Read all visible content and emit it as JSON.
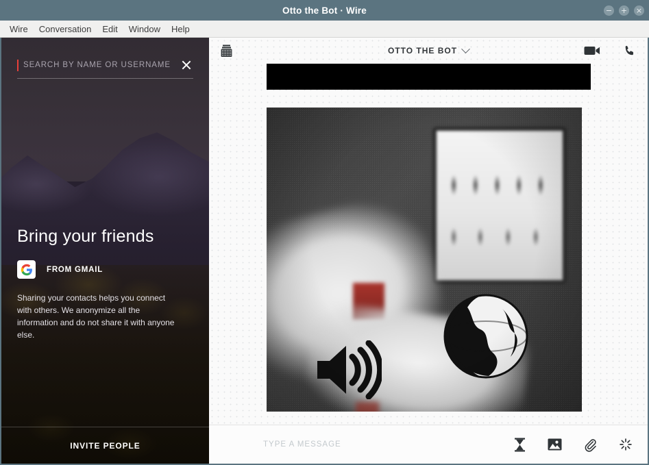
{
  "window": {
    "title": "Otto the Bot · Wire",
    "controls": [
      {
        "name": "minimize",
        "glyph": "−"
      },
      {
        "name": "maximize",
        "glyph": "+"
      },
      {
        "name": "close",
        "glyph": "×"
      }
    ]
  },
  "menubar": {
    "items": [
      "Wire",
      "Conversation",
      "Edit",
      "Window",
      "Help"
    ]
  },
  "sidebar": {
    "search": {
      "value": "",
      "placeholder": "SEARCH BY NAME OR USERNAME",
      "clear_icon": "close-icon",
      "caret_color": "#e8403a"
    },
    "invite": {
      "title": "Bring your friends",
      "gmail_label": "FROM GMAIL",
      "gmail_icon": "google-g-icon",
      "description": "Sharing your contacts helps you connect with others. We anonymize all the information and do not share it with anyone else.",
      "button_label": "INVITE PEOPLE"
    }
  },
  "conversation": {
    "header": {
      "archive_icon": "collections-icon",
      "title": "OTTO THE BOT",
      "chevron_icon": "chevron-down-icon",
      "video_icon": "video-camera-icon",
      "call_icon": "phone-icon"
    },
    "messages": [
      {
        "type": "image",
        "name": "black-bar-image"
      },
      {
        "type": "image",
        "name": "photo-message"
      }
    ]
  },
  "composer": {
    "placeholder": "TYPE A MESSAGE",
    "value": "",
    "icons": [
      {
        "name": "timer-hourglass-icon"
      },
      {
        "name": "image-icon"
      },
      {
        "name": "paperclip-icon"
      },
      {
        "name": "ping-icon"
      }
    ]
  },
  "colors": {
    "titlebar": "#5b7480",
    "accent_red": "#e8403a",
    "menubar": "#f0f0ef",
    "conversation_bg": "#fafafa"
  }
}
